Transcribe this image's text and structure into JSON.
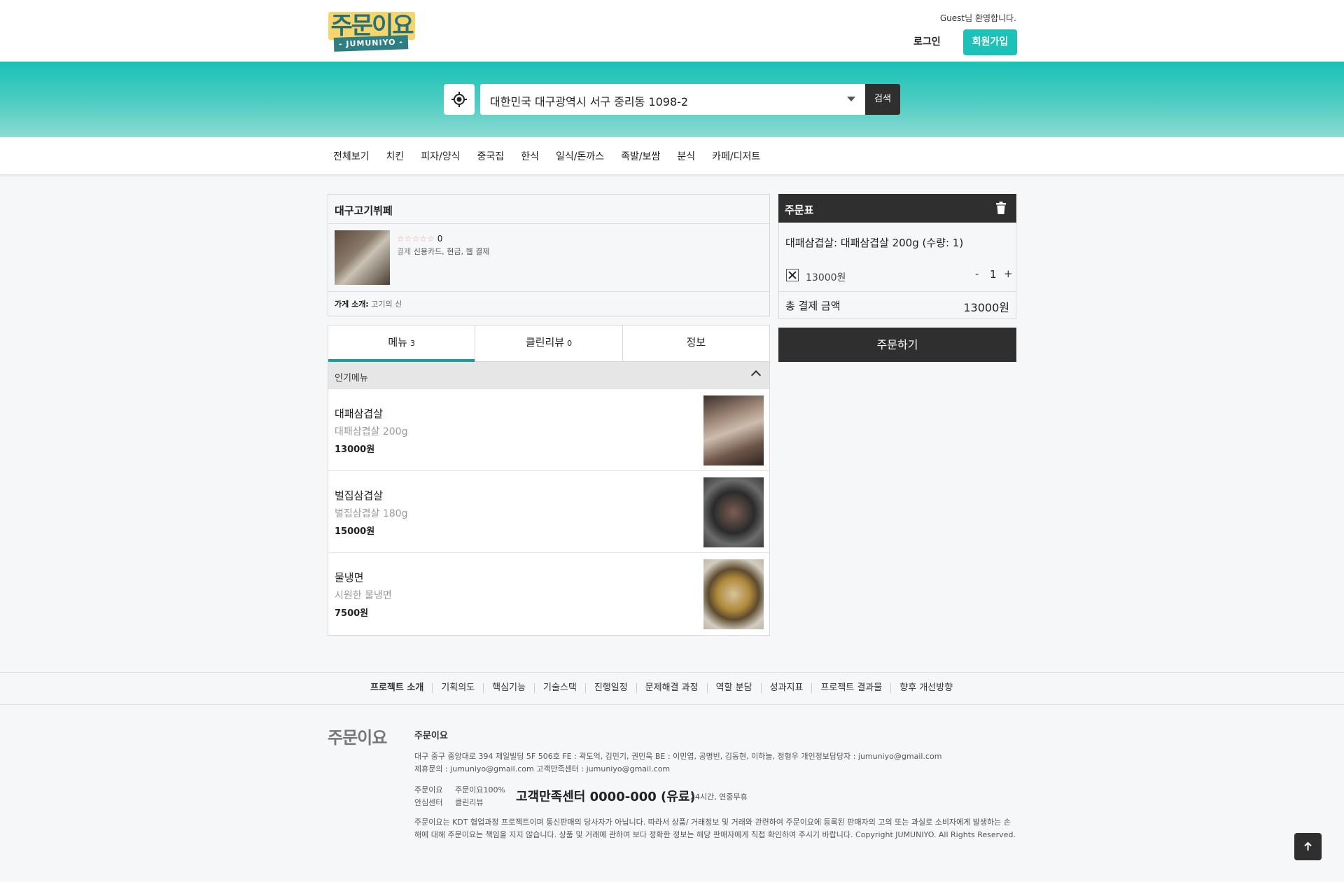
{
  "header": {
    "logo_text": "주문이요",
    "logo_sub": "- JUMUNIYO -",
    "welcome": "Guest님 환영합니다.",
    "login_label": "로그인",
    "signup_label": "회원가입"
  },
  "search": {
    "address": "대한민국 대구광역시 서구 중리동 1098-2",
    "button_label": "검색"
  },
  "categories": [
    "전체보기",
    "치킨",
    "피자/양식",
    "중국집",
    "한식",
    "일식/돈까스",
    "족발/보쌈",
    "분식",
    "카페/디저트"
  ],
  "store": {
    "name": "대구고기뷔페",
    "stars": "☆☆☆☆☆",
    "rating_count": "0",
    "pay_label": "결제",
    "pay_methods": "신용카드, 현금, 웹 결제",
    "intro_label": "가게 소개:",
    "intro_text": "고기의 신"
  },
  "tabs": [
    {
      "label": "메뉴",
      "count": "3"
    },
    {
      "label": "클린리뷰",
      "count": "0"
    },
    {
      "label": "정보",
      "count": ""
    }
  ],
  "menu": {
    "section_title": "인기메뉴",
    "items": [
      {
        "name": "대패삼겹살",
        "desc": "대패삼겹살 200g",
        "price": "13000원"
      },
      {
        "name": "벌집삼겹살",
        "desc": "벌집삼겹살 180g",
        "price": "15000원"
      },
      {
        "name": "물냉면",
        "desc": "시원한 물냉면",
        "price": "7500원"
      }
    ]
  },
  "order": {
    "title": "주문표",
    "line": "대패삼겹살: 대패삼겹살 200g (수량: 1)",
    "item_price": "13000원",
    "minus": "-",
    "qty": "1",
    "plus": "+",
    "total_label": "총 결제 금액",
    "total_value": "13000원",
    "order_button": "주문하기"
  },
  "footer": {
    "links": [
      "프로젝트 소개",
      "기획의도",
      "핵심기능",
      "기술스택",
      "진행일정",
      "문제해결 과정",
      "역할 분담",
      "성과지표",
      "프로젝트 결과물",
      "향후 개선방향"
    ],
    "logo": "주문이요",
    "name": "주문이요",
    "address_line": "대구 중구 중앙대로 394 제일빌딩 5F 506호    FE : 곽도억, 김민기, 권민욱    BE : 이민엽, 공명빈, 김동현, 이하늘, 정형우    개인정보담당자 : jumuniyo@gmail.com",
    "contact_line": "제휴문의 : jumuniyo@gmail.com    고객만족센터 : jumuniyo@gmail.com",
    "mini1": "주문이요     주문이요100%",
    "mini2": "안심센터     클린리뷰",
    "cs_center": "고객만족센터 0000-000 (유료)",
    "cs_hours": "24시간, 연중무휴",
    "disclaimer": "주문이요는 KDT 협업과정 프로젝트이며 통신판매의 당사자가 아닙니다. 따라서 상품/ 거래정보 및 거래와 관련하여 주문이요에 등록된 판매자의 고의 또는 과실로 소비자에게 발생하는 손해에 대해 주문이요는 책임을 지지 않습니다. 상품 및 거래에 관하여 보다 정확한 정보는 해당 판매자에게 직접 확인하여 주시기 바랍니다. Copyright JUMUNIYO. All Rights Reserved."
  }
}
